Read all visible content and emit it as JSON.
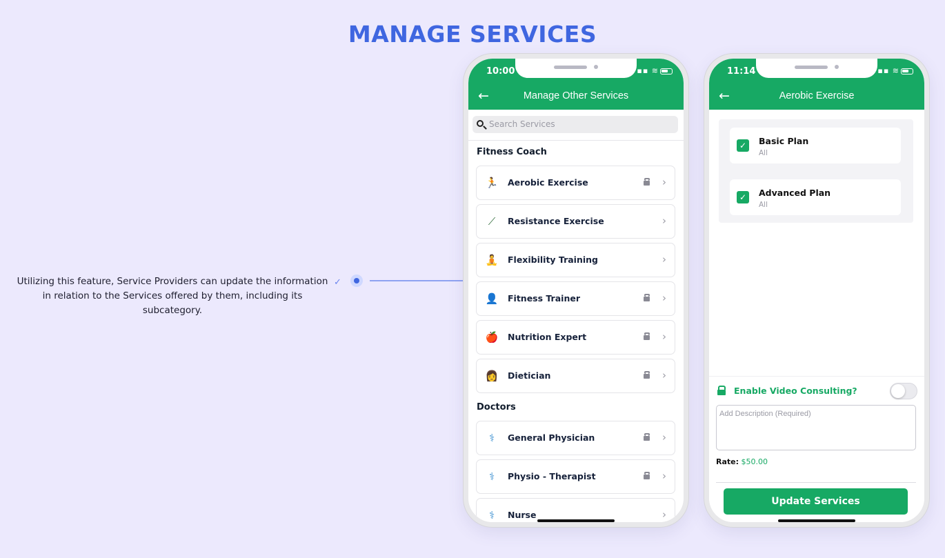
{
  "page": {
    "title": "MANAGE SERVICES",
    "annotation": "Utilizing this feature, Service Providers can update the information in relation to the Services offered by them, including its subcategory."
  },
  "colors": {
    "accent": "#3f66e0",
    "brand_green": "#17a964",
    "background": "#ece9fd"
  },
  "phone1": {
    "time": "10:00",
    "title": "Manage Other Services",
    "search_placeholder": "Search Services",
    "sections": [
      {
        "heading": "Fitness Coach",
        "items": [
          {
            "label": "Aerobic Exercise",
            "icon": "aerobic-icon",
            "video": true
          },
          {
            "label": "Resistance Exercise",
            "icon": "resistance-band-icon",
            "video": false
          },
          {
            "label": "Flexibility Training",
            "icon": "stretching-icon",
            "video": false
          },
          {
            "label": "Fitness Trainer",
            "icon": "trainer-icon",
            "video": true
          },
          {
            "label": "Nutrition Expert",
            "icon": "nutrition-icon",
            "video": true
          },
          {
            "label": "Dietician",
            "icon": "dietician-icon",
            "video": true
          }
        ]
      },
      {
        "heading": "Doctors",
        "items": [
          {
            "label": "General Physician",
            "icon": "physician-icon",
            "video": true
          },
          {
            "label": "Physio - Therapist",
            "icon": "therapist-icon",
            "video": true
          },
          {
            "label": "Nurse",
            "icon": "nurse-icon",
            "video": false
          }
        ]
      }
    ]
  },
  "phone2": {
    "time": "11:14",
    "title": "Aerobic Exercise",
    "plans": [
      {
        "name": "Basic Plan",
        "sub": "All",
        "checked": true
      },
      {
        "name": "Advanced Plan",
        "sub": "All",
        "checked": true
      }
    ],
    "video_consulting_label": "Enable Video Consulting?",
    "video_consulting_enabled": false,
    "description_placeholder": "Add Description (Required)",
    "rate_label": "Rate:",
    "rate_value": "$50.00",
    "update_button": "Update Services"
  }
}
